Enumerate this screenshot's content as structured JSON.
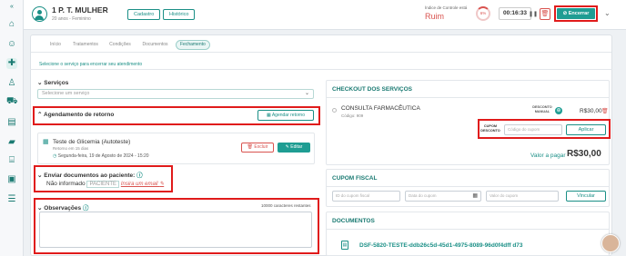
{
  "rail": {
    "icons": [
      "collapse-icon",
      "home-icon",
      "user-icon",
      "pill-icon",
      "user-plus-icon",
      "truck-icon",
      "chart-icon",
      "folder-icon",
      "bank-icon",
      "id-card-icon",
      "report-icon"
    ]
  },
  "header": {
    "patient_name": "1 P. T. MULHER",
    "patient_sub": "20 anos - Feminino",
    "cadastro_label": "Cadastro",
    "historico_label": "Histórico",
    "indice_label": "Índice de Controle está",
    "indice_value": "Ruim",
    "indice_percent": "6%",
    "timer": "00:16:33",
    "encerrar_label": "Encerrar"
  },
  "tabs": [
    {
      "label": "Início"
    },
    {
      "label": "Tratamentos"
    },
    {
      "label": "Condições"
    },
    {
      "label": "Documentos"
    },
    {
      "label": "Fechamento"
    }
  ],
  "hint": "Selecione o serviço para encerrar seu atendimento",
  "servicos": {
    "title": "Serviços",
    "placeholder": "Selecione um serviço"
  },
  "agendamento": {
    "title": "Agendamento de retorno",
    "button": "Agendar retorno",
    "exam_title": "Teste de Glicemia (Autoteste)",
    "exam_sub": "Retorno em 15 dias",
    "exam_date": "Segunda-feira, 19 de Agosto de 2024 - 15:20",
    "excluir": "Excluir",
    "editar": "Editar"
  },
  "documentos": {
    "title": "Enviar documentos ao paciente:",
    "status": "Não informado",
    "paciente": "PACIENTE",
    "email_link": "Insira um email"
  },
  "observacoes": {
    "title": "Observações",
    "chars_left": "10000 caracteres restantes"
  },
  "checkout": {
    "title": "CHECKOUT DOS SERVIÇOS",
    "item_name": "CONSULTA FARMACÊUTICA",
    "item_code": "Código: 909",
    "desconto_manual": "DESCONTO MANUAL",
    "item_price": "R$30,00",
    "cupom_label": "CUPOM DESCONTO",
    "cupom_placeholder": "Código do cupom",
    "aplicar": "Aplicar",
    "valor_label": "Valor a pagar",
    "valor_total": "R$30,00"
  },
  "cupom_fiscal": {
    "title": "CUPOM FISCAL",
    "id_placeholder": "ID do cupom fiscal",
    "data_placeholder": "Data do cupom",
    "valor_placeholder": "Valor do cupom",
    "vincular": "Vincular"
  },
  "documentos_panel": {
    "title": "DOCUMENTOS",
    "file": "DSF-5820-TESTE-ddb26c5d-45d1-4975-8089-96d0f4dff d73"
  },
  "colors": {
    "accent": "#1f9d93",
    "danger": "#d9534f",
    "highlight": "#e01b1b"
  }
}
